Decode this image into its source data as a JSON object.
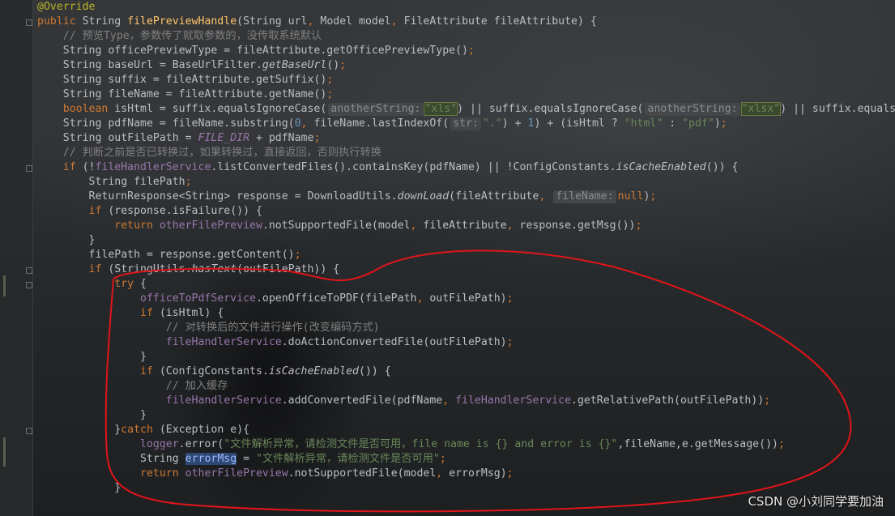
{
  "editor": {
    "lines": [
      [
        {
          "c": "ann",
          "t": "@Override"
        }
      ],
      [
        {
          "c": "kw",
          "t": "public "
        },
        {
          "c": "",
          "t": "String "
        },
        {
          "c": "fn",
          "t": "filePreviewHandle"
        },
        {
          "c": "",
          "t": "(String url"
        },
        {
          "c": "sem",
          "t": ", "
        },
        {
          "c": "",
          "t": "Model model"
        },
        {
          "c": "sem",
          "t": ", "
        },
        {
          "c": "",
          "t": "FileAttribute fileAttribute) {"
        }
      ],
      [
        {
          "c": "cmt",
          "t": "    // 预览Type，参数传了就取参数的，没传取系统默认"
        }
      ],
      [
        {
          "c": "",
          "t": "    String officePreviewType = fileAttribute.getOfficePreviewType()"
        },
        {
          "c": "sem",
          "t": ";"
        }
      ],
      [
        {
          "c": "",
          "t": "    String baseUrl = BaseUrlFilter."
        },
        {
          "c": "ital",
          "t": "getBaseUrl"
        },
        {
          "c": "",
          "t": "()"
        },
        {
          "c": "sem",
          "t": ";"
        }
      ],
      [
        {
          "c": "",
          "t": "    String suffix = fileAttribute.getSuffix()"
        },
        {
          "c": "sem",
          "t": ";"
        }
      ],
      [
        {
          "c": "",
          "t": "    String fileName = fileAttribute.getName()"
        },
        {
          "c": "sem",
          "t": ";"
        }
      ],
      [
        {
          "c": "kw",
          "t": "    boolean "
        },
        {
          "c": "",
          "t": "isHtml = suffix.equalsIgnoreCase("
        },
        {
          "c": "hint",
          "t": "anotherString:"
        },
        {
          "c": "str strhl",
          "t": "\"xls\""
        },
        {
          "c": "",
          "t": ") || suffix.equalsIgnoreCase("
        },
        {
          "c": "hint",
          "t": "anotherString:"
        },
        {
          "c": "str strhl2",
          "t": "\"xlsx\""
        },
        {
          "c": "",
          "t": ") || suffix.equalsIg"
        }
      ],
      [
        {
          "c": "",
          "t": "    String pdfName = fileName.substring("
        },
        {
          "c": "num",
          "t": "0"
        },
        {
          "c": "sem",
          "t": ", "
        },
        {
          "c": "",
          "t": "fileName.lastIndexOf("
        },
        {
          "c": "hint",
          "t": "str:"
        },
        {
          "c": "str",
          "t": "\".\""
        },
        {
          "c": "",
          "t": ") + "
        },
        {
          "c": "num",
          "t": "1"
        },
        {
          "c": "",
          "t": ") + (isHtml ? "
        },
        {
          "c": "str",
          "t": "\"html\""
        },
        {
          "c": "",
          "t": " : "
        },
        {
          "c": "str",
          "t": "\"pdf\""
        },
        {
          "c": "",
          "t": ")"
        },
        {
          "c": "sem",
          "t": ";"
        }
      ],
      [
        {
          "c": "",
          "t": "    String outFilePath = "
        },
        {
          "c": "sfld",
          "t": "FILE_DIR"
        },
        {
          "c": "",
          "t": " + pdfName"
        },
        {
          "c": "sem",
          "t": ";"
        }
      ],
      [
        {
          "c": "cmt",
          "t": "    // 判断之前是否已转换过，如果转换过，直接返回，否则执行转换"
        }
      ],
      [
        {
          "c": "kw",
          "t": "    if "
        },
        {
          "c": "",
          "t": "(!"
        },
        {
          "c": "fld",
          "t": "fileHandlerService"
        },
        {
          "c": "",
          "t": ".listConvertedFiles().containsKey(pdfName) || !ConfigConstants."
        },
        {
          "c": "ital",
          "t": "isCacheEnabled"
        },
        {
          "c": "",
          "t": "()) {"
        }
      ],
      [
        {
          "c": "",
          "t": "        String filePath"
        },
        {
          "c": "sem",
          "t": ";"
        }
      ],
      [
        {
          "c": "",
          "t": "        ReturnResponse<String> response = DownloadUtils."
        },
        {
          "c": "ital",
          "t": "downLoad"
        },
        {
          "c": "",
          "t": "(fileAttribute"
        },
        {
          "c": "sem",
          "t": ", "
        },
        {
          "c": "hint",
          "t": "fileName:"
        },
        {
          "c": "kw",
          "t": "null"
        },
        {
          "c": "",
          "t": ")"
        },
        {
          "c": "sem",
          "t": ";"
        }
      ],
      [
        {
          "c": "kw",
          "t": "        if "
        },
        {
          "c": "",
          "t": "(response.isFailure()) {"
        }
      ],
      [
        {
          "c": "kw",
          "t": "            return "
        },
        {
          "c": "fld",
          "t": "otherFilePreview"
        },
        {
          "c": "",
          "t": ".notSupportedFile(model"
        },
        {
          "c": "sem",
          "t": ", "
        },
        {
          "c": "",
          "t": "fileAttribute"
        },
        {
          "c": "sem",
          "t": ", "
        },
        {
          "c": "",
          "t": "response.getMsg())"
        },
        {
          "c": "sem",
          "t": ";"
        }
      ],
      [
        {
          "c": "",
          "t": "        }"
        }
      ],
      [
        {
          "c": "",
          "t": "        filePath = response.getContent()"
        },
        {
          "c": "sem",
          "t": ";"
        }
      ],
      [
        {
          "c": "kw",
          "t": "        if "
        },
        {
          "c": "",
          "t": "(StringUtils."
        },
        {
          "c": "ital",
          "t": "hasText"
        },
        {
          "c": "",
          "t": "(outFilePath)) {"
        }
      ],
      [
        {
          "c": "kw",
          "t": "            try "
        },
        {
          "c": "",
          "t": "{"
        }
      ],
      [
        {
          "c": "fld",
          "t": "                officeToPdfService"
        },
        {
          "c": "",
          "t": ".openOfficeToPDF(filePath"
        },
        {
          "c": "sem",
          "t": ", "
        },
        {
          "c": "",
          "t": "outFilePath)"
        },
        {
          "c": "sem",
          "t": ";"
        }
      ],
      [
        {
          "c": "kw",
          "t": "                if "
        },
        {
          "c": "",
          "t": "(isHtml) {"
        }
      ],
      [
        {
          "c": "cmt",
          "t": "                    // 对转换后的文件进行操作(改变编码方式)"
        }
      ],
      [
        {
          "c": "fld",
          "t": "                    fileHandlerService"
        },
        {
          "c": "",
          "t": ".doActionConvertedFile(outFilePath)"
        },
        {
          "c": "sem",
          "t": ";"
        }
      ],
      [
        {
          "c": "",
          "t": "                }"
        }
      ],
      [
        {
          "c": "kw",
          "t": "                if "
        },
        {
          "c": "",
          "t": "(ConfigConstants."
        },
        {
          "c": "ital",
          "t": "isCacheEnabled"
        },
        {
          "c": "",
          "t": "()) {"
        }
      ],
      [
        {
          "c": "cmt",
          "t": "                    // 加入缓存"
        }
      ],
      [
        {
          "c": "fld",
          "t": "                    fileHandlerService"
        },
        {
          "c": "",
          "t": ".addConvertedFile(pdfName"
        },
        {
          "c": "sem",
          "t": ", "
        },
        {
          "c": "fld",
          "t": "fileHandlerService"
        },
        {
          "c": "",
          "t": ".getRelativePath(outFilePath))"
        },
        {
          "c": "sem",
          "t": ";"
        }
      ],
      [
        {
          "c": "",
          "t": "                }"
        }
      ],
      [
        {
          "c": "",
          "t": "            }"
        },
        {
          "c": "kw",
          "t": "catch "
        },
        {
          "c": "",
          "t": "(Exception e){"
        }
      ],
      [
        {
          "c": "fld",
          "t": "                logger"
        },
        {
          "c": "",
          "t": ".error("
        },
        {
          "c": "str",
          "t": "\"文件解析异常，请检测文件是否可用，file name is {} and error is {}\""
        },
        {
          "c": "",
          "t": ",fileName,e.getMessage())"
        },
        {
          "c": "sem",
          "t": ";"
        }
      ],
      [
        {
          "c": "",
          "t": "                String "
        },
        {
          "c": "selvar",
          "t": "errorMsg"
        },
        {
          "c": "",
          "t": " = "
        },
        {
          "c": "str",
          "t": "\"文件解析异常，请检测文件是否可用\""
        },
        {
          "c": "sem",
          "t": ";"
        }
      ],
      [
        {
          "c": "kw",
          "t": "                return "
        },
        {
          "c": "fld",
          "t": "otherFilePreview"
        },
        {
          "c": "",
          "t": ".notSupportedFile(model"
        },
        {
          "c": "sem",
          "t": ", "
        },
        {
          "c": "",
          "t": "errorMsg)"
        },
        {
          "c": "sem",
          "t": ";"
        }
      ],
      [
        {
          "c": "",
          "t": "            }"
        }
      ]
    ]
  },
  "watermark": "CSDN @小刘同学要加油",
  "colors": {
    "keyword": "#cc7832",
    "string": "#6a8759",
    "field": "#9876aa",
    "method_decl": "#ffc66d",
    "comment": "#808080",
    "annotation_circle": "#e0151a"
  }
}
